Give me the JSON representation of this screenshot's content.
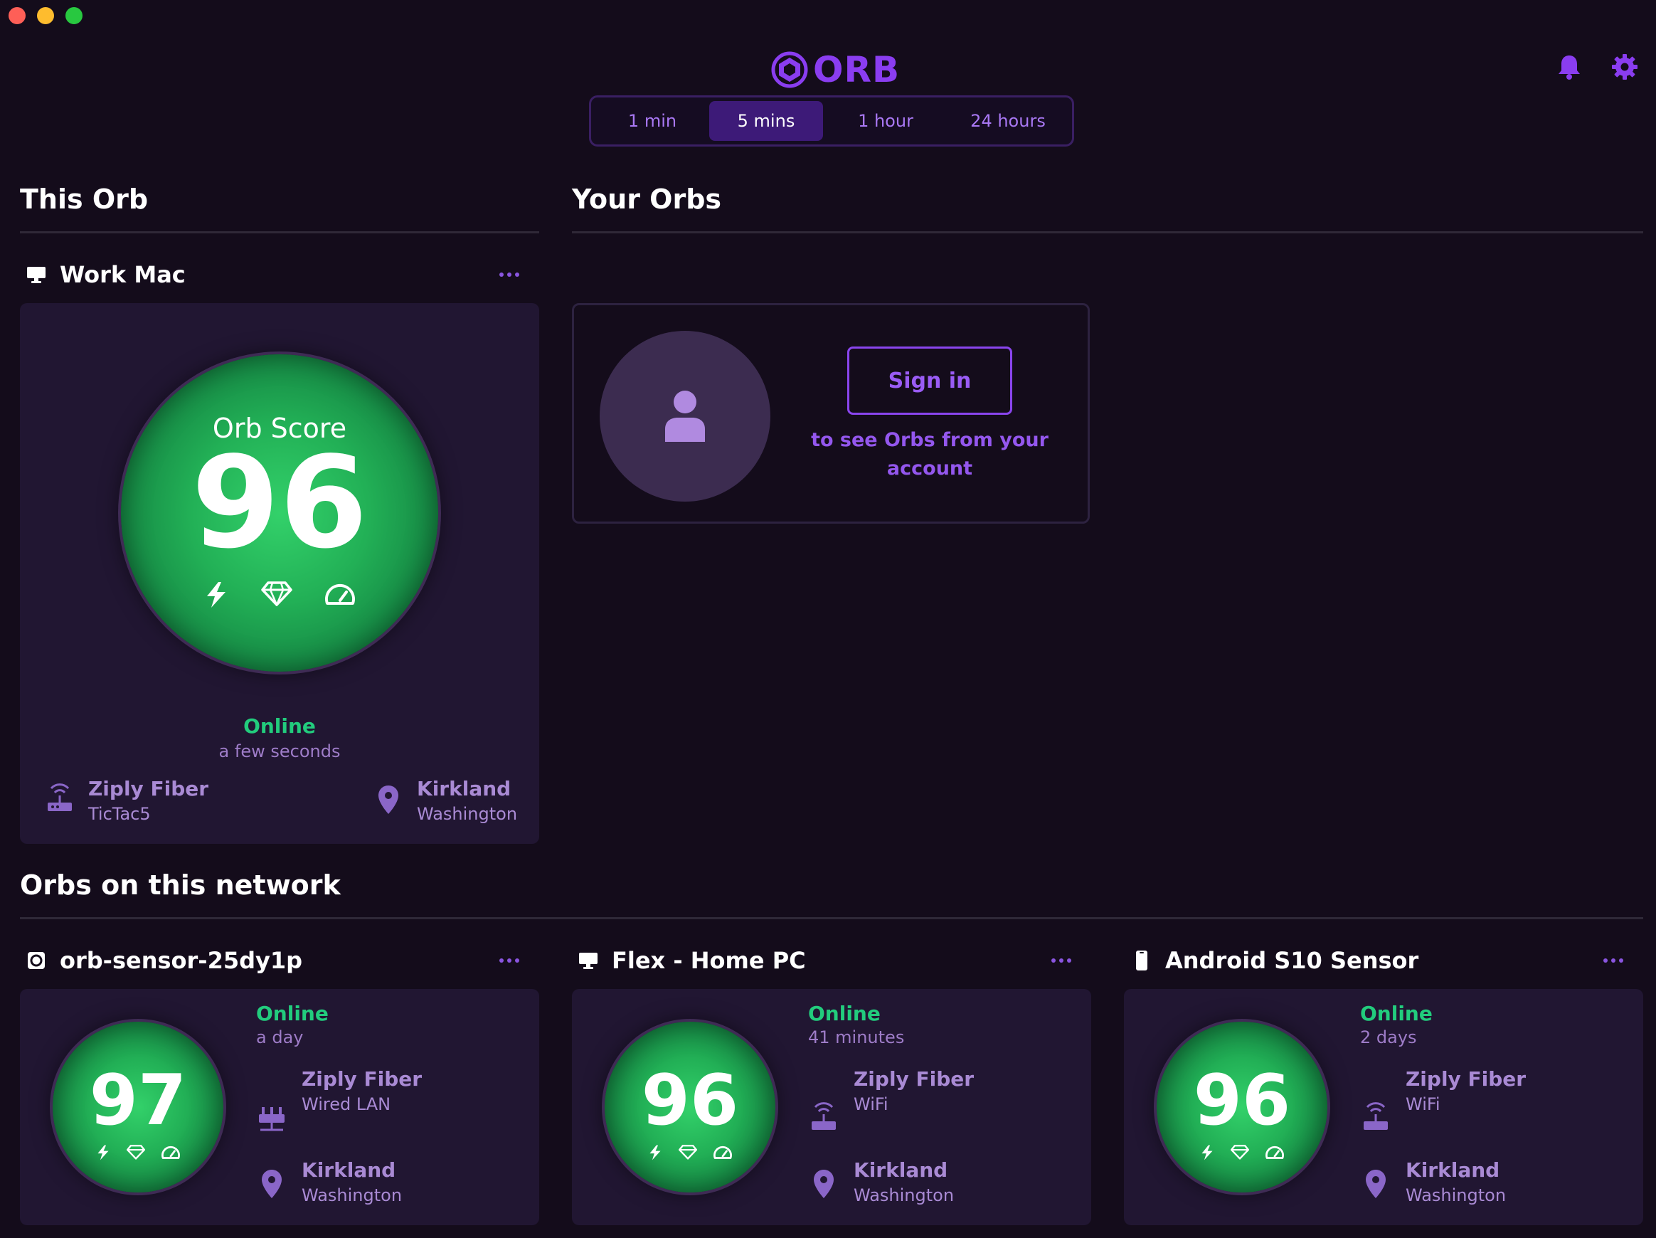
{
  "app": {
    "logo_text": "ORB"
  },
  "time_tabs": [
    {
      "label": "1 min",
      "active": false
    },
    {
      "label": "5 mins",
      "active": true
    },
    {
      "label": "1 hour",
      "active": false
    },
    {
      "label": "24 hours",
      "active": false
    }
  ],
  "this_orb": {
    "title": "This Orb",
    "device": {
      "name": "Work Mac",
      "icon": "desktop-icon",
      "score_label": "Orb Score",
      "score": "96",
      "status": "Online",
      "last_seen": "a few seconds",
      "isp": "Ziply Fiber",
      "network": "TicTac5",
      "city": "Kirkland",
      "region": "Washington"
    }
  },
  "your_orbs": {
    "title": "Your Orbs",
    "signin_button": "Sign in",
    "signin_text": "to see Orbs from your account"
  },
  "network_orbs": {
    "title": "Orbs on this network",
    "devices": [
      {
        "name": "orb-sensor-25dy1p",
        "icon": "sensor-icon",
        "score": "97",
        "status": "Online",
        "last_seen": "a day",
        "isp": "Ziply Fiber",
        "network": "Wired LAN",
        "city": "Kirkland",
        "region": "Washington"
      },
      {
        "name": "Flex - Home PC",
        "icon": "desktop-icon",
        "score": "96",
        "status": "Online",
        "last_seen": "41 minutes",
        "isp": "Ziply Fiber",
        "network": "WiFi",
        "city": "Kirkland",
        "region": "Washington"
      },
      {
        "name": "Android S10 Sensor",
        "icon": "phone-icon",
        "score": "96",
        "status": "Online",
        "last_seen": "2 days",
        "isp": "Ziply Fiber",
        "network": "WiFi",
        "city": "Kirkland",
        "region": "Washington"
      }
    ]
  },
  "colors": {
    "background": "#140c1b",
    "accent": "#8a3df0",
    "online": "#22cc7d",
    "card": "#211632"
  }
}
